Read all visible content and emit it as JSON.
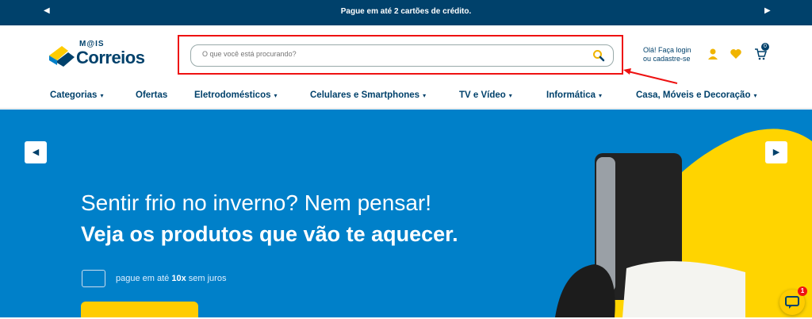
{
  "promo_bar": {
    "message": "Pague em até 2 cartões de crédito.",
    "prev_icon": "chevron-left-icon",
    "next_icon": "chevron-right-icon"
  },
  "header": {
    "logo_top": "M@IS",
    "logo_brand": "Correios",
    "search": {
      "placeholder": "O que você está procurando?",
      "icon": "search-icon"
    },
    "login": {
      "line1": "Olá! Faça login",
      "line2": "ou cadastre-se"
    },
    "cart_count": "0",
    "icons": [
      "user-icon",
      "heart-icon",
      "cart-icon"
    ]
  },
  "nav": {
    "items": [
      {
        "label": "Categorias",
        "caret": "▾"
      },
      {
        "label": "Ofertas",
        "caret": ""
      },
      {
        "label": "Eletrodomésticos",
        "caret": "▾"
      },
      {
        "label": "Celulares e Smartphones",
        "caret": "▾"
      },
      {
        "label": "TV e Vídeo",
        "caret": "▾"
      },
      {
        "label": "Informática",
        "caret": "▾"
      },
      {
        "label": "Casa, Móveis e Decoração",
        "caret": "▾"
      }
    ]
  },
  "hero": {
    "line1": "Sentir frio no inverno? Nem pensar!",
    "line2": "Veja os produtos que vão te aquecer.",
    "pay_prefix": "pague em até ",
    "pay_bold": "10x",
    "pay_suffix": " sem juros",
    "cta_label": "→"
  },
  "chat": {
    "count": "1"
  },
  "colors": {
    "brand_blue": "#00416b",
    "hero_blue": "#0080c9",
    "yellow": "#ffcc00",
    "highlight_red": "#e11"
  }
}
